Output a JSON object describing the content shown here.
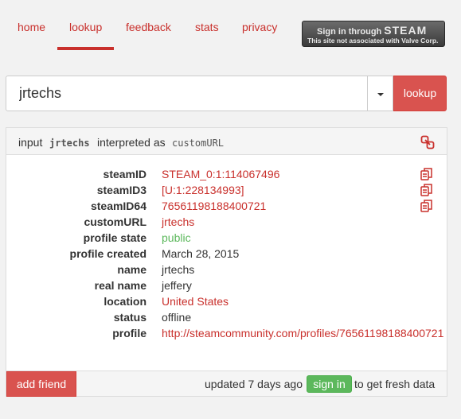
{
  "nav": {
    "items": [
      "home",
      "lookup",
      "feedback",
      "stats",
      "privacy"
    ],
    "active": "lookup"
  },
  "steam_signin": {
    "line1": "Sign in through",
    "brand": "STEAM",
    "line2": "This site not associated with Valve Corp."
  },
  "search": {
    "value": "jrtechs",
    "button": "lookup"
  },
  "panel": {
    "input_label": "input",
    "input_value": "jrtechs",
    "interpreted_label": "interpreted as",
    "interpreted_value": "customURL",
    "rows": [
      {
        "key": "steamID",
        "value": "STEAM_0:1:114067496",
        "style": "link",
        "copy": true
      },
      {
        "key": "steamID3",
        "value": "[U:1:228134993]",
        "style": "link",
        "copy": true
      },
      {
        "key": "steamID64",
        "value": "76561198188400721",
        "style": "link",
        "copy": true
      },
      {
        "key": "customURL",
        "value": "jrtechs",
        "style": "link",
        "copy": false
      },
      {
        "key": "profile state",
        "value": "public",
        "style": "green",
        "copy": false
      },
      {
        "key": "profile created",
        "value": "March 28, 2015",
        "style": "plain",
        "copy": false
      },
      {
        "key": "name",
        "value": "jrtechs",
        "style": "plain",
        "copy": false
      },
      {
        "key": "real name",
        "value": "jeffery",
        "style": "plain",
        "copy": false
      },
      {
        "key": "location",
        "value": "United States",
        "style": "link",
        "copy": false
      },
      {
        "key": "status",
        "value": "offline",
        "style": "plain",
        "copy": false
      },
      {
        "key": "profile",
        "value": "http://steamcommunity.com/profiles/76561198188400721",
        "style": "link",
        "copy": false
      }
    ],
    "footer": {
      "add_friend": "add friend",
      "updated": "updated 7 days ago",
      "signin": "sign in",
      "suffix": "to get fresh data"
    }
  },
  "colors": {
    "accent": "#c9302c",
    "button_red": "#d9534f",
    "green": "#5cb85c"
  },
  "icons": {
    "copy": "copy-icon",
    "link": "link-icon",
    "caret": "caret-down-icon"
  }
}
